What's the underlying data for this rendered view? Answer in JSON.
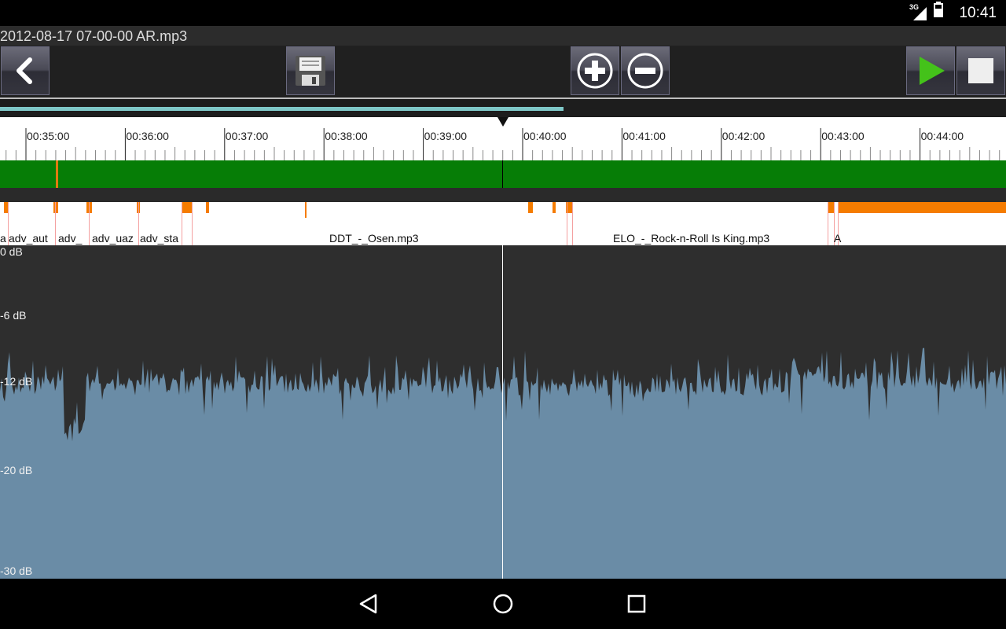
{
  "status_bar": {
    "network": "3G",
    "time": "10:41"
  },
  "title": "2012-08-17 07-00-00 AR.mp3",
  "toolbar": {
    "back": "back-icon",
    "save": "floppy-disk-icon",
    "zoom_in": "plus-circle-icon",
    "zoom_out": "minus-circle-icon",
    "play": "play-icon",
    "stop": "stop-icon"
  },
  "playback_progress": 0.56,
  "timeline": {
    "ticks": [
      "00:35:00",
      "00:36:00",
      "00:37:00",
      "00:38:00",
      "00:39:00",
      "00:40:00",
      "00:41:00",
      "00:42:00",
      "00:43:00",
      "00:44:00"
    ]
  },
  "tracks": [
    "a",
    "adv_aut",
    "adv_",
    "adv_uaz",
    "adv_sta",
    "DDT_-_Osen.mp3",
    "ELO_-_Rock-n-Roll Is King.mp3",
    "A"
  ],
  "db_scale": [
    "0 dB",
    "-6 dB",
    "-12 dB",
    "-20 dB",
    "-30 dB"
  ],
  "colors": {
    "timeline_lane": "#067d06",
    "marker": "#f57c00",
    "waveform": "#6a8ca6",
    "progress": "#7fc8c8"
  },
  "nav": {
    "back": "nav-back-icon",
    "home": "nav-home-icon",
    "recents": "nav-recents-icon"
  }
}
